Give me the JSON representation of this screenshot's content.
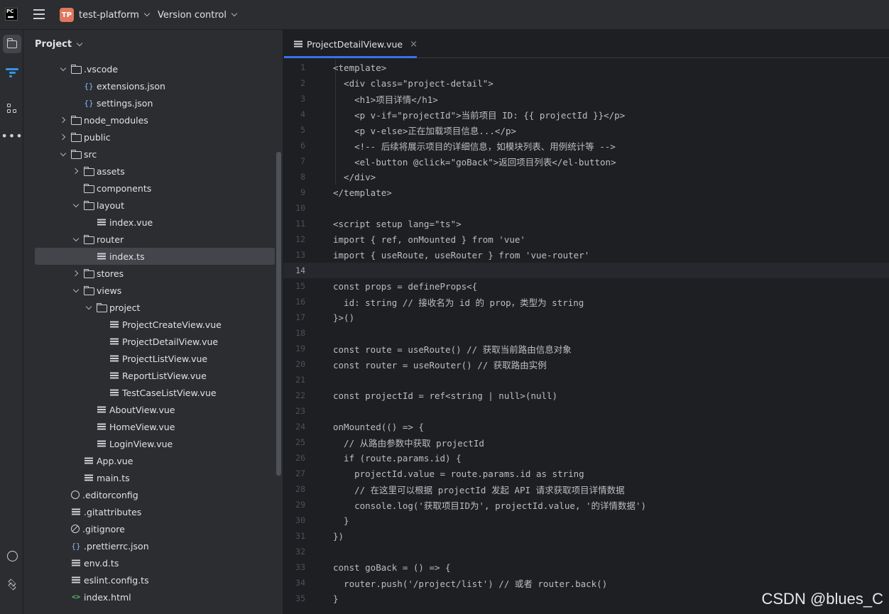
{
  "titlebar": {
    "logo_text": "PC",
    "project_badge": "TP",
    "project_name": "test-platform",
    "vcs_label": "Version control"
  },
  "activity": {
    "items": [
      "project-icon",
      "vcs-icon",
      "structure-icon",
      "more-icon",
      "python-console-icon",
      "services-icon"
    ]
  },
  "project_panel": {
    "title": "Project",
    "tree": [
      {
        "label": ".vscode",
        "type": "folder",
        "depth": 2,
        "state": "open"
      },
      {
        "label": "extensions.json",
        "type": "json",
        "depth": 3
      },
      {
        "label": "settings.json",
        "type": "json",
        "depth": 3
      },
      {
        "label": "node_modules",
        "type": "folder",
        "depth": 2,
        "state": "closed"
      },
      {
        "label": "public",
        "type": "folder",
        "depth": 2,
        "state": "closed"
      },
      {
        "label": "src",
        "type": "folder",
        "depth": 2,
        "state": "open"
      },
      {
        "label": "assets",
        "type": "folder",
        "depth": 3,
        "state": "closed"
      },
      {
        "label": "components",
        "type": "folder",
        "depth": 3,
        "state": "none"
      },
      {
        "label": "layout",
        "type": "folder",
        "depth": 3,
        "state": "open"
      },
      {
        "label": "index.vue",
        "type": "file",
        "depth": 4
      },
      {
        "label": "router",
        "type": "folder",
        "depth": 3,
        "state": "open"
      },
      {
        "label": "index.ts",
        "type": "file",
        "depth": 4,
        "selected": true
      },
      {
        "label": "stores",
        "type": "folder",
        "depth": 3,
        "state": "closed"
      },
      {
        "label": "views",
        "type": "folder",
        "depth": 3,
        "state": "open"
      },
      {
        "label": "project",
        "type": "folder",
        "depth": 4,
        "state": "open"
      },
      {
        "label": "ProjectCreateView.vue",
        "type": "file",
        "depth": 5
      },
      {
        "label": "ProjectDetailView.vue",
        "type": "file",
        "depth": 5
      },
      {
        "label": "ProjectListView.vue",
        "type": "file",
        "depth": 5
      },
      {
        "label": "ReportListView.vue",
        "type": "file",
        "depth": 5
      },
      {
        "label": "TestCaseListView.vue",
        "type": "file",
        "depth": 5
      },
      {
        "label": "AboutView.vue",
        "type": "file",
        "depth": 4
      },
      {
        "label": "HomeView.vue",
        "type": "file",
        "depth": 4
      },
      {
        "label": "LoginView.vue",
        "type": "file",
        "depth": 4
      },
      {
        "label": "App.vue",
        "type": "file",
        "depth": 3
      },
      {
        "label": "main.ts",
        "type": "file",
        "depth": 3
      },
      {
        "label": ".editorconfig",
        "type": "cfg",
        "depth": 2
      },
      {
        "label": ".gitattributes",
        "type": "file",
        "depth": 2
      },
      {
        "label": ".gitignore",
        "type": "ban",
        "depth": 2
      },
      {
        "label": ".prettierrc.json",
        "type": "json",
        "depth": 2
      },
      {
        "label": "env.d.ts",
        "type": "file",
        "depth": 2
      },
      {
        "label": "eslint.config.ts",
        "type": "file",
        "depth": 2
      },
      {
        "label": "index.html",
        "type": "html",
        "depth": 2
      }
    ]
  },
  "editor": {
    "tab_label": "ProjectDetailView.vue",
    "tab_close": "×",
    "current_line": 14,
    "lines": [
      "<template>",
      "  <div class=\"project-detail\">",
      "    <h1>项目详情</h1>",
      "    <p v-if=\"projectId\">当前项目 ID: {{ projectId }}</p>",
      "    <p v-else>正在加载项目信息...</p>",
      "    <!-- 后续将展示项目的详细信息，如模块列表、用例统计等 -->",
      "    <el-button @click=\"goBack\">返回项目列表</el-button>",
      "  </div>",
      "</template>",
      "",
      "<script setup lang=\"ts\">",
      "import { ref, onMounted } from 'vue'",
      "import { useRoute, useRouter } from 'vue-router'",
      "",
      "const props = defineProps<{",
      "  id: string // 接收名为 id 的 prop，类型为 string",
      "}>()",
      "",
      "const route = useRoute() // 获取当前路由信息对象",
      "const router = useRouter() // 获取路由实例",
      "",
      "const projectId = ref<string | null>(null)",
      "",
      "onMounted(() => {",
      "  // 从路由参数中获取 projectId",
      "  if (route.params.id) {",
      "    projectId.value = route.params.id as string",
      "    // 在这里可以根据 projectId 发起 API 请求获取项目详情数据",
      "    console.log('获取项目ID为', projectId.value, '的详情数据')",
      "  }",
      "})",
      "",
      "const goBack = () => {",
      "  router.push('/project/list') // 或者 router.back()",
      "}"
    ]
  },
  "watermark": "CSDN @blues_C"
}
